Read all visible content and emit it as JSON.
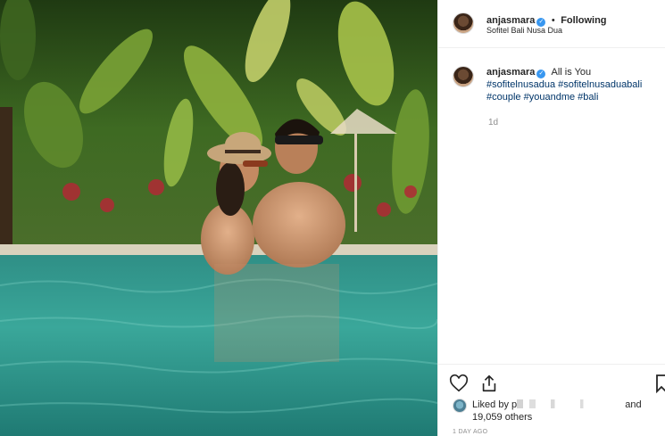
{
  "post": {
    "username": "anjasmara",
    "verified_badge": "verified-badge-icon",
    "separator": "•",
    "follow_status": "Following",
    "location": "Sofitel Bali Nusa Dua",
    "caption": {
      "username": "anjasmara",
      "text": "All is You",
      "hashtags": [
        "#sofitelnusadua",
        "#sofitelnusaduabali",
        "#couple",
        "#youandme",
        "#bali"
      ]
    },
    "relative_time": "1d",
    "likes": {
      "prefix": "Liked by",
      "obscured_name": "p",
      "and": "and",
      "count_text": "19,059 others"
    },
    "posted_ago": "1 DAY AGO"
  },
  "icons": {
    "like": "heart-outline-icon",
    "share": "share-icon",
    "save": "bookmark-icon"
  },
  "colors": {
    "text": "#262626",
    "muted": "#8e8e8e",
    "hashtag": "#003569",
    "verified": "#3897f0",
    "border": "#efefef"
  }
}
